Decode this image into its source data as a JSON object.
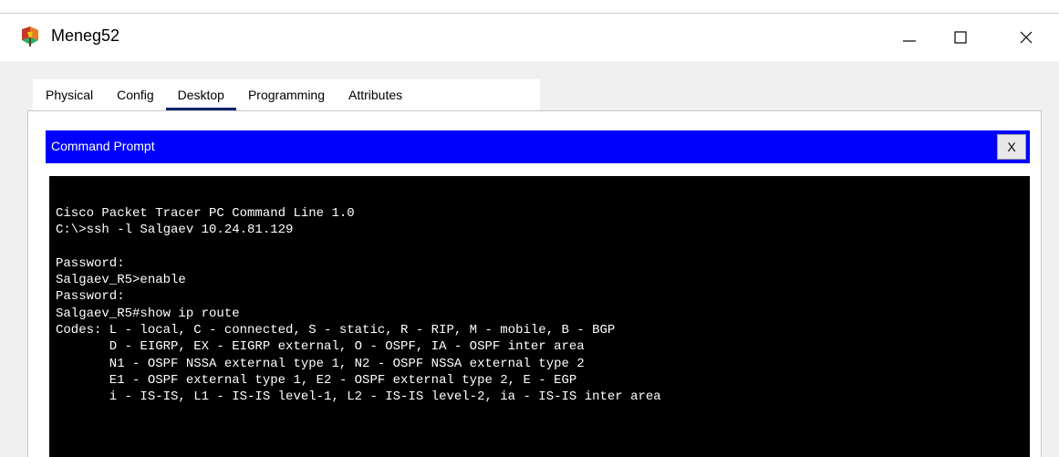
{
  "window": {
    "title": "Meneg52",
    "controls": {
      "minimize": "minimize",
      "maximize": "maximize",
      "close": "close"
    }
  },
  "tabs": [
    {
      "label": "Physical",
      "active": false
    },
    {
      "label": "Config",
      "active": false
    },
    {
      "label": "Desktop",
      "active": true
    },
    {
      "label": "Programming",
      "active": false
    },
    {
      "label": "Attributes",
      "active": false
    }
  ],
  "command_prompt": {
    "title": "Command Prompt",
    "close_label": "X",
    "lines": [
      "Cisco Packet Tracer PC Command Line 1.0",
      "C:\\>ssh -l Salgaev 10.24.81.129",
      "",
      "Password:",
      "Salgaev_R5>enable",
      "Password:",
      "Salgaev_R5#show ip route",
      "Codes: L - local, C - connected, S - static, R - RIP, M - mobile, B - BGP",
      "       D - EIGRP, EX - EIGRP external, O - OSPF, IA - OSPF inter area",
      "       N1 - OSPF NSSA external type 1, N2 - OSPF NSSA external type 2",
      "       E1 - OSPF external type 1, E2 - OSPF external type 2, E - EGP",
      "       i - IS-IS, L1 - IS-IS level-1, L2 - IS-IS level-2, ia - IS-IS inter area"
    ]
  },
  "colors": {
    "header_blue": "#0000ff",
    "terminal_bg": "#000000",
    "terminal_fg": "#ffffff",
    "active_tab_underline": "#0a246a"
  }
}
